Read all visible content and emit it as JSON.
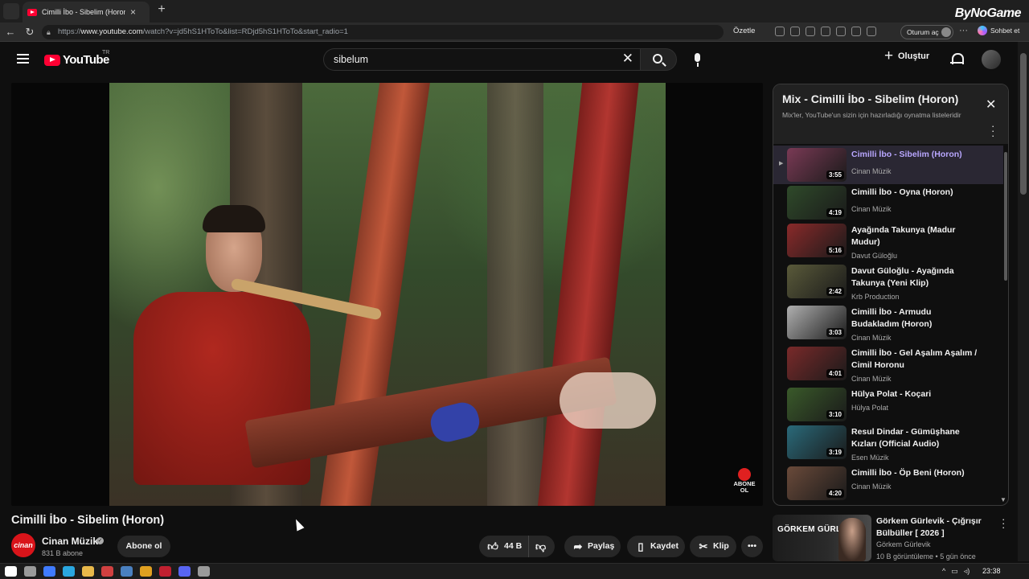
{
  "browser": {
    "tab_title": "Cimilli İbo - Sibelim (Horon)",
    "url_prefix": "https://",
    "url_domain": "www.youtube.com",
    "url_path": "/watch?v=jd5hS1HToTo&list=RDjd5hS1HToTo&start_radio=1",
    "summarize_label": "Özetle",
    "signin_label": "Oturum aç",
    "copilot_label": "Sohbet et",
    "watermark": "ByNoGame"
  },
  "header": {
    "logo_text": "YouTube",
    "country_code": "TR",
    "search_value": "sibelum",
    "create_label": "Oluştur"
  },
  "video": {
    "title": "Cimilli İbo - Sibelim (Horon)",
    "overlay_subscribe": [
      "ABONE",
      "OL"
    ],
    "channel_logo_text": "cinan",
    "channel_name": "Cinan Müzik",
    "subscribers": "831 B abone",
    "subscribe_label": "Abone ol",
    "likes": "44 B",
    "share_label": "Paylaş",
    "save_label": "Kaydet",
    "clip_label": "Klip"
  },
  "mix": {
    "title": "Mix - Cimilli İbo - Sibelim (Horon)",
    "subtitle": "Mix'ler, YouTube'un sizin için hazırladığı oynatma listeleridir",
    "items": [
      {
        "title": "Cimilli İbo - Sibelim (Horon)",
        "channel": "Cinan Müzik",
        "duration": "3:55",
        "active": true,
        "thumb": "#7a3a55"
      },
      {
        "title": "Cimilli İbo - Oyna (Horon)",
        "channel": "Cinan Müzik",
        "duration": "4:19",
        "thumb": "#2f4a2a"
      },
      {
        "title": "Ayağında Takunya (Madur Mudur)",
        "channel": "Davut Güloğlu",
        "duration": "5:16",
        "thumb": "#8a2a2a"
      },
      {
        "title": "Davut Güloğlu - Ayağında Takunya (Yeni Klip)",
        "channel": "Krb Production",
        "duration": "2:42",
        "thumb": "#5a5a3a"
      },
      {
        "title": "Cimilli İbo - Armudu Budakladım (Horon)",
        "channel": "Cinan Müzik",
        "duration": "3:03",
        "thumb": "#b0b0b0"
      },
      {
        "title": "Cimilli İbo - Gel Aşalım Aşalım / Cimil Horonu",
        "channel": "Cinan Müzik",
        "duration": "4:01",
        "thumb": "#7a2a2a"
      },
      {
        "title": "Hülya Polat - Koçari",
        "channel": "Hülya Polat",
        "duration": "3:10",
        "thumb": "#3a5a2a"
      },
      {
        "title": "Resul Dindar - Gümüşhane Kızları (Official Audio)",
        "channel": "Esen Müzik",
        "duration": "3:19",
        "thumb": "#2a6a7a"
      },
      {
        "title": "Cimilli İbo - Öp Beni (Horon)",
        "channel": "Cinan Müzik",
        "duration": "4:20",
        "thumb": "#6a4a3a"
      }
    ]
  },
  "recommendation": {
    "thumb_title": "GÖRKEM GÜRLEVİK",
    "title": "Görkem Gürlevik - Çığrışır Bülbüller [ 2026 ]",
    "channel": "Görkem Gürlevik",
    "meta": "10 B görüntüleme • 5 gün önce"
  },
  "taskbar": {
    "clock": "23:38",
    "icon_colors": [
      "#ffffff",
      "#9a9a9a",
      "#3f7bff",
      "#2aa7e0",
      "#e8b84a",
      "#d04040",
      "#4a80c0",
      "#e0a020",
      "#c02030",
      "#5865f2",
      "#9a9a9a"
    ]
  }
}
